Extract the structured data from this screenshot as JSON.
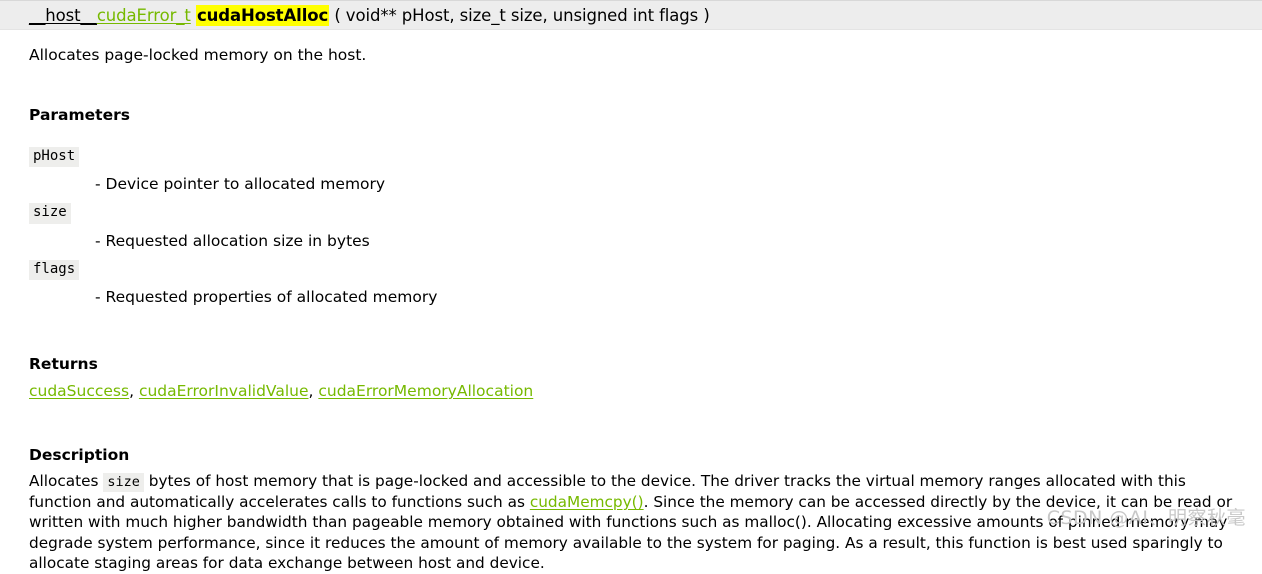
{
  "signature": {
    "host_qualifier": "__host__",
    "return_type": "cudaError_t",
    "function_name": "cudaHostAlloc",
    "parameter_list": "( void** pHost, size_t size, unsigned int  flags )",
    "highlight_color": "#ffff00",
    "link_color": "#76b900",
    "bar_background": "#ededed"
  },
  "brief": "Allocates page-locked memory on the host.",
  "sections": {
    "parameters_title": "Parameters",
    "returns_title": "Returns",
    "description_title": "Description"
  },
  "parameters": [
    {
      "name": "pHost",
      "description": "- Device pointer to allocated memory"
    },
    {
      "name": "size",
      "description": "- Requested allocation size in bytes"
    },
    {
      "name": "flags",
      "description": "- Requested properties of allocated memory"
    }
  ],
  "returns": {
    "links": [
      "cudaSuccess",
      "cudaErrorInvalidValue",
      "cudaErrorMemoryAllocation"
    ],
    "separator": ", "
  },
  "description": {
    "part1": "Allocates ",
    "code1": "size",
    "part2": " bytes of host memory that is page-locked and accessible to the device. The driver tracks the virtual memory ranges allocated with this function and automatically accelerates calls to functions such as ",
    "link1": "cudaMemcpy()",
    "part3": ". Since the memory can be accessed directly by the device, it can be read or written with much higher bandwidth than pageable memory obtained with functions such as malloc(). Allocating excessive amounts of pinned memory may degrade system performance, since it reduces the amount of memory available to the system for paging. As a result, this function is best used sparingly to allocate staging areas for data exchange between host and device."
  },
  "watermark": "CSDN @AI、明察秋毫"
}
